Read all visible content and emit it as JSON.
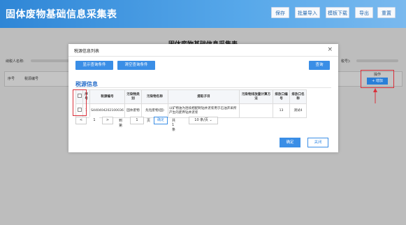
{
  "app": {
    "title": "固体废物基础信息采集表",
    "toolbar": [
      "保存",
      "批量导入",
      "模板下载",
      "导出",
      "重置"
    ]
  },
  "page": {
    "title": "固体废物基础信息采集表",
    "taxpayer_label": "纳税人名称:",
    "right_label": "税号):",
    "table_headers": [
      "序号",
      "税源编号"
    ],
    "op_label": "操作",
    "add_button": "+ 增加"
  },
  "modal": {
    "title": "税源信息列表",
    "close_icon": "close-icon",
    "buttons": {
      "show_query": "显示查询条件",
      "clear_query": "清空查询条件",
      "query": "查询"
    },
    "section_title": "税源信息",
    "columns": [
      "序号",
      "税源编号",
      "污染物类别",
      "污染物名称",
      "提取子目",
      "污染物排放量计算方法",
      "排放口编号",
      "排放口名称"
    ],
    "rows": [
      {
        "index": "1",
        "source_no": "S440404202100036",
        "category": "固体废物",
        "name": "危险废物(固)",
        "sub_item": "以矿物油为连续相配制钻井泥浆用于石油开采所产生的废弃钻井泥浆",
        "method": "",
        "outlet_no": "13",
        "outlet_name": "测试4"
      }
    ],
    "pager": {
      "prev": "<",
      "page": "1",
      "next": ">",
      "goto_label": "到第",
      "goto_value": "1",
      "page_unit": "页",
      "confirm": "确定",
      "total": "共 1 条",
      "page_size": "10 条/页"
    },
    "ok": "确定",
    "close": "关闭"
  },
  "colors": {
    "accent": "#3a8ee6",
    "highlight": "#d9303a"
  }
}
